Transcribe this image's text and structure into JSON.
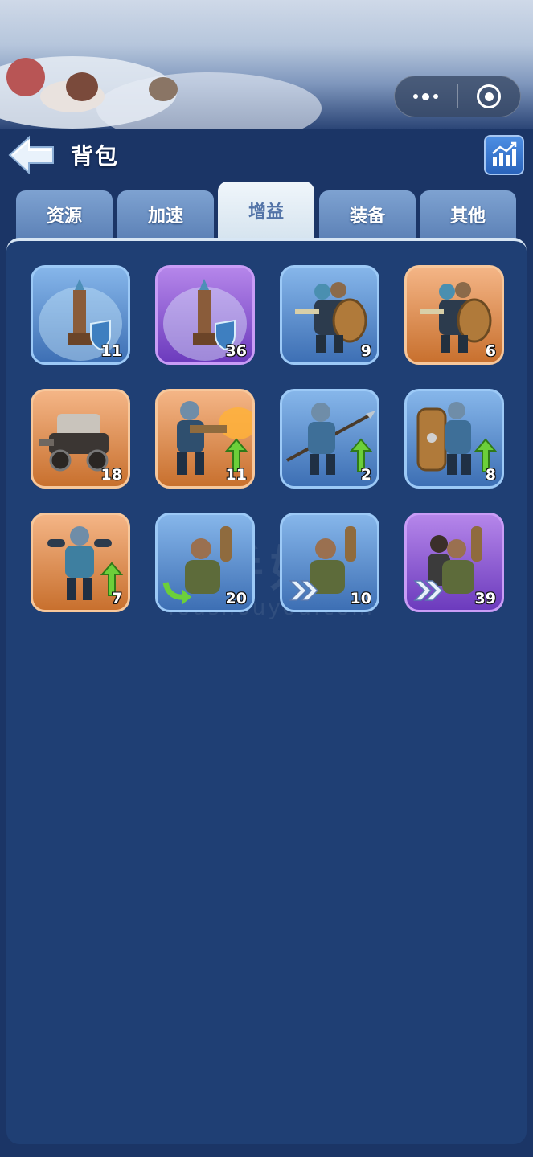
{
  "header": {
    "title": "背包"
  },
  "tabs": [
    {
      "label": "资源",
      "active": false
    },
    {
      "label": "加速",
      "active": false
    },
    {
      "label": "增益",
      "active": true
    },
    {
      "label": "装备",
      "active": false
    },
    {
      "label": "其他",
      "active": false
    }
  ],
  "items": [
    {
      "icon": "shield-tower-icon",
      "rarity": "blue",
      "count": "11"
    },
    {
      "icon": "shield-tower-icon",
      "rarity": "purple",
      "count": "36"
    },
    {
      "icon": "soldier-squad-icon",
      "rarity": "blue",
      "count": "9"
    },
    {
      "icon": "soldier-squad-icon",
      "rarity": "orange",
      "count": "6"
    },
    {
      "icon": "siege-machine-icon",
      "rarity": "orange",
      "count": "18"
    },
    {
      "icon": "flamethrower-upgrade-icon",
      "rarity": "orange",
      "count": "11"
    },
    {
      "icon": "spearman-upgrade-icon",
      "rarity": "blue",
      "count": "2"
    },
    {
      "icon": "shield-bearer-upgrade-icon",
      "rarity": "blue",
      "count": "8"
    },
    {
      "icon": "brawler-upgrade-icon",
      "rarity": "orange",
      "count": "7"
    },
    {
      "icon": "worker-recycle-icon",
      "rarity": "blue",
      "count": "20"
    },
    {
      "icon": "worker-speed-icon",
      "rarity": "blue",
      "count": "10"
    },
    {
      "icon": "worker-group-speed-icon",
      "rarity": "purple",
      "count": "39"
    }
  ],
  "watermark": {
    "text": "游手好游",
    "sub": "Youshouyou.com"
  }
}
